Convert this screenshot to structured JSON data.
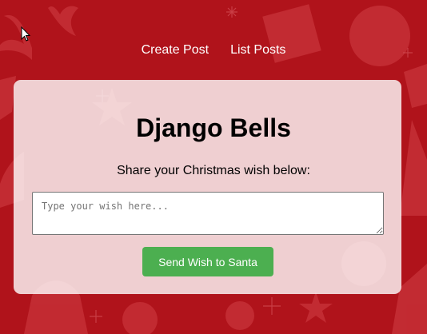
{
  "nav": {
    "items": [
      {
        "label": "Create Post"
      },
      {
        "label": "List Posts"
      }
    ]
  },
  "page": {
    "title": "Django Bells",
    "subtitle": "Share your Christmas wish below:"
  },
  "form": {
    "wish_value": "",
    "wish_placeholder": "Type your wish here...",
    "submit_label": "Send Wish to Santa"
  },
  "colors": {
    "background": "#b0131b",
    "pattern": "#c8333a",
    "card": "#f3d2d5",
    "button": "#4caf50",
    "button_text": "#ffffff",
    "nav_text": "#ffffff"
  },
  "icons": [
    "mouse-cursor-icon",
    "christmas-pattern-background"
  ]
}
